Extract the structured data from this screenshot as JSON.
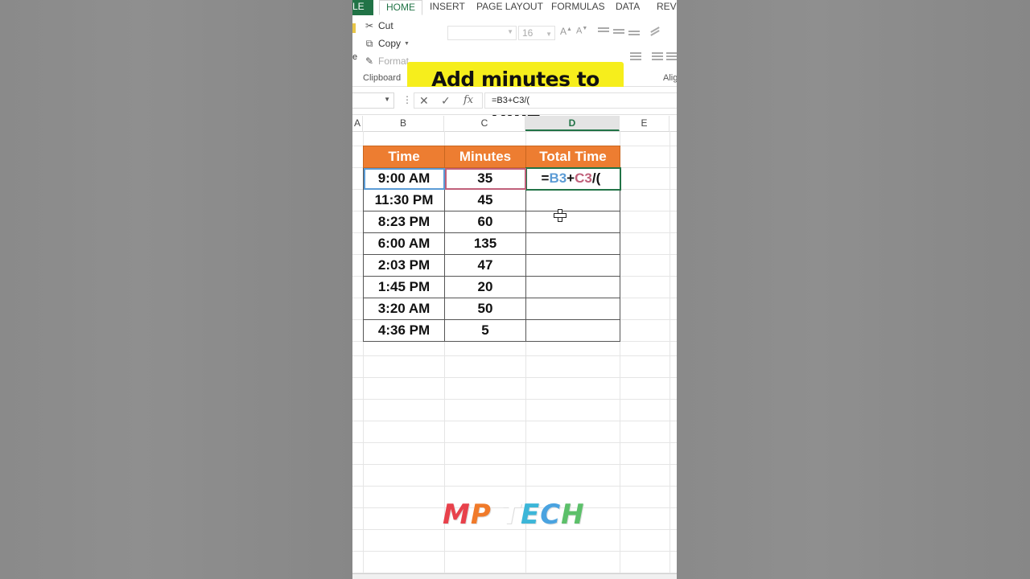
{
  "ribbon": {
    "tabs": [
      "LE",
      "HOME",
      "INSERT",
      "PAGE LAYOUT",
      "FORMULAS",
      "DATA",
      "REVI"
    ],
    "clipboard": {
      "cut_label": "Cut",
      "copy_label": "Copy",
      "format_label": "Format",
      "paste_edge": "e",
      "group_label": "Clipboard"
    },
    "font_size": "16",
    "align_group_label": "Alig"
  },
  "banner": {
    "text": "Add minutes to time"
  },
  "formula_bar": {
    "fx_label": "fx",
    "formula": "=B3+C3/("
  },
  "columns": [
    "A",
    "B",
    "C",
    "D",
    "E"
  ],
  "selected_column": "D",
  "table": {
    "headers": [
      "Time",
      "Minutes",
      "Total Time"
    ],
    "rows": [
      [
        "9:00 AM",
        "35"
      ],
      [
        "11:30 PM",
        "45"
      ],
      [
        "8:23 PM",
        "60"
      ],
      [
        "6:00 AM",
        "135"
      ],
      [
        "2:03 PM",
        "47"
      ],
      [
        "1:45 PM",
        "20"
      ],
      [
        "3:20 AM",
        "50"
      ],
      [
        "4:36 PM",
        "5"
      ]
    ],
    "editing_cell": {
      "eq": "=",
      "ref1": "B3",
      "plus": "+",
      "ref2": "C3",
      "rest": "/("
    }
  },
  "logo": {
    "text": "MP TECH"
  },
  "colors": {
    "header_bg": "#ed7d31",
    "banner_bg": "#f6ee1c",
    "excel_green": "#217346",
    "ref1": "#5b9bd5",
    "ref2": "#c0607a"
  }
}
